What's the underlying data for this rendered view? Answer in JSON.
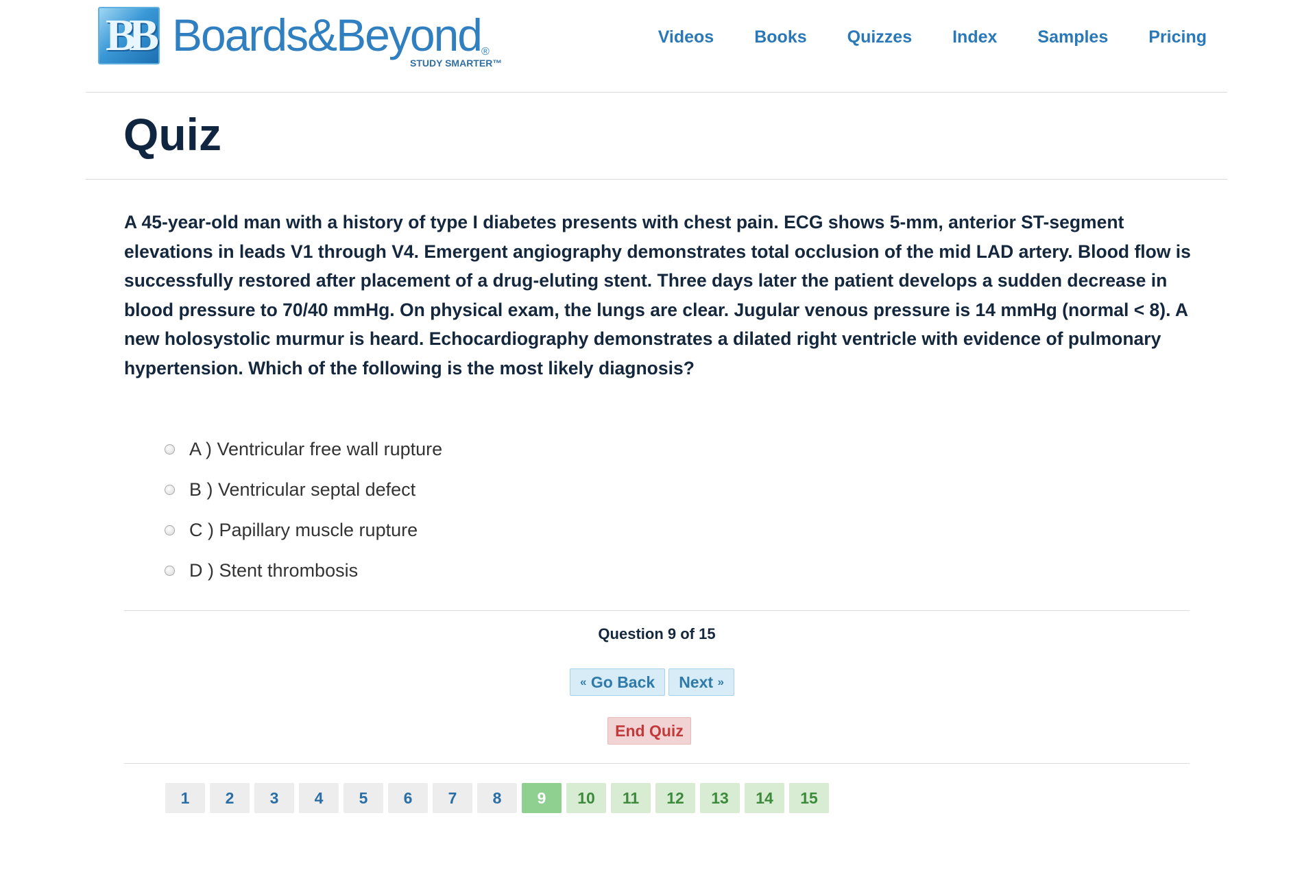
{
  "header": {
    "logo_badge": "BB",
    "logo_name": "Boards&Beyond",
    "logo_registered": "®",
    "logo_tagline": "STUDY SMARTER™",
    "nav": [
      "Videos",
      "Books",
      "Quizzes",
      "Index",
      "Samples",
      "Pricing"
    ]
  },
  "page_title": "Quiz",
  "question": {
    "text": "A 45-year-old man with a history of type I diabetes presents with chest pain. ECG shows 5-mm, anterior ST-segment elevations in leads V1 through V4. Emergent angiography demonstrates total occlusion of the mid LAD artery. Blood flow is successfully restored after placement of a drug-eluting stent. Three days later the patient develops a sudden decrease in blood pressure to 70/40 mmHg. On physical exam, the lungs are clear. Jugular venous pressure is 14 mmHg (normal < 8). A new holosystolic murmur is heard. Echocardiography demonstrates a dilated right ventricle with evidence of pulmonary hypertension. Which of the following is the most likely diagnosis?",
    "answers": [
      "A ) Ventricular free wall rupture",
      "B ) Ventricular septal defect",
      "C ) Papillary muscle rupture",
      "D ) Stent thrombosis"
    ],
    "selected": null
  },
  "progress": {
    "counter": "Question 9 of 15",
    "current": 9,
    "total": 15
  },
  "controls": {
    "back_label": "Go Back",
    "back_arrow": "«",
    "next_label": "Next",
    "next_arrow": "»",
    "end_label": "End Quiz"
  },
  "pager": [
    "1",
    "2",
    "3",
    "4",
    "5",
    "6",
    "7",
    "8",
    "9",
    "10",
    "11",
    "12",
    "13",
    "14",
    "15"
  ],
  "colors": {
    "brand_blue": "#2a78b8",
    "title_navy": "#10253f",
    "current_page": "#8fcf8f",
    "pending_page": "#d7ecd2",
    "end_quiz": "#c0393b"
  }
}
